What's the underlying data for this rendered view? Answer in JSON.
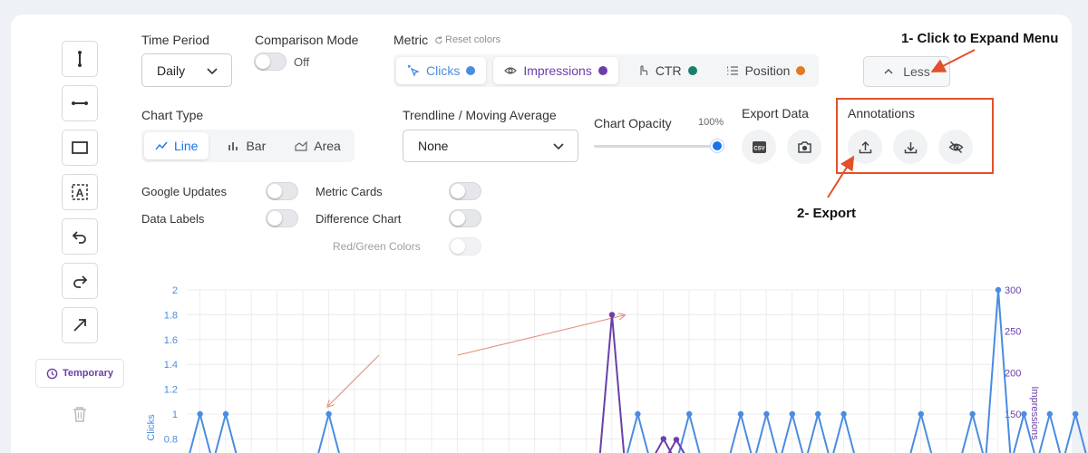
{
  "toolbar": {
    "tools": [
      {
        "name": "vertical-line-tool",
        "icon": "vertical-line-icon"
      },
      {
        "name": "horizontal-line-tool",
        "icon": "horizontal-line-icon"
      },
      {
        "name": "rectangle-tool",
        "icon": "rectangle-icon"
      },
      {
        "name": "text-tool",
        "icon": "text-box-icon"
      },
      {
        "name": "undo-tool",
        "icon": "undo-icon"
      },
      {
        "name": "redo-tool",
        "icon": "redo-icon"
      },
      {
        "name": "arrow-tool",
        "icon": "arrow-icon"
      }
    ],
    "temporary_label": "Temporary",
    "delete_icon": "trash-icon"
  },
  "controls": {
    "time_period": {
      "label": "Time Period",
      "value": "Daily"
    },
    "comparison_mode": {
      "label": "Comparison Mode",
      "state": "Off"
    },
    "metric": {
      "label": "Metric",
      "reset_label": "Reset colors",
      "options": [
        {
          "label": "Clicks",
          "color": "#4a8ce0",
          "icon": "cursor-click-icon",
          "active": true
        },
        {
          "label": "Impressions",
          "color": "#6b3fa8",
          "icon": "eye-icon",
          "active": true
        },
        {
          "label": "CTR",
          "color": "#1a7f6e",
          "icon": "pointer-icon",
          "active": false
        },
        {
          "label": "Position",
          "color": "#e07b1f",
          "icon": "list-icon",
          "active": false
        }
      ]
    },
    "less_label": "Less",
    "chart_type": {
      "label": "Chart Type",
      "options": [
        {
          "label": "Line",
          "icon": "line-chart-icon",
          "active": true
        },
        {
          "label": "Bar",
          "icon": "bar-chart-icon",
          "active": false
        },
        {
          "label": "Area",
          "icon": "area-chart-icon",
          "active": false
        }
      ]
    },
    "trendline": {
      "label": "Trendline / Moving Average",
      "value": "None"
    },
    "chart_opacity": {
      "label": "Chart Opacity",
      "value": "100%"
    },
    "export_data": {
      "label": "Export Data",
      "buttons": [
        "csv-icon",
        "camera-icon"
      ]
    },
    "annotations": {
      "label": "Annotations",
      "buttons": [
        "upload-icon",
        "download-icon",
        "eye-off-icon"
      ]
    },
    "toggles": {
      "google_updates": "Google Updates",
      "data_labels": "Data Labels",
      "metric_cards": "Metric Cards",
      "difference_chart": "Difference Chart",
      "red_green_colors": "Red/Green Colors"
    }
  },
  "callouts": {
    "expand_menu": "1- Click to Expand Menu",
    "export": "2- Export"
  },
  "colors": {
    "accent": "#4a8ce0",
    "impressions": "#6b3fa8",
    "annotation_red": "#e3502b"
  },
  "chart_data": {
    "type": "line",
    "ylabel": "Clicks",
    "y2label": "Impressions",
    "left_ticks": [
      "2",
      "1.8",
      "1.6",
      "1.4",
      "1.2",
      "1",
      "0.8"
    ],
    "right_ticks": [
      "300",
      "250",
      "200",
      "150"
    ],
    "left_ylim_visible": [
      0.8,
      2
    ],
    "right_ylim_visible": [
      100,
      300
    ],
    "series": [
      {
        "name": "Clicks",
        "axis": "left",
        "visible_points": [
          {
            "x": 2,
            "y": 1
          },
          {
            "x": 3,
            "y": 1
          },
          {
            "x": 7,
            "y": 1
          },
          {
            "x": 19,
            "y": 1
          },
          {
            "x": 21,
            "y": 1
          },
          {
            "x": 23,
            "y": 1
          },
          {
            "x": 24,
            "y": 1
          },
          {
            "x": 25,
            "y": 1
          },
          {
            "x": 26,
            "y": 1
          },
          {
            "x": 27,
            "y": 1
          },
          {
            "x": 30,
            "y": 1
          },
          {
            "x": 32,
            "y": 1
          },
          {
            "x": 33,
            "y": 2
          },
          {
            "x": 34,
            "y": 1
          },
          {
            "x": 35,
            "y": 1
          },
          {
            "x": 36,
            "y": 1
          },
          {
            "x": 37,
            "y": 1
          }
        ]
      },
      {
        "name": "Impressions",
        "axis": "right",
        "visible_points": [
          {
            "x": 18,
            "y": 270
          },
          {
            "x": 20,
            "y": 120
          },
          {
            "x": 20.5,
            "y": 119
          }
        ]
      }
    ]
  }
}
